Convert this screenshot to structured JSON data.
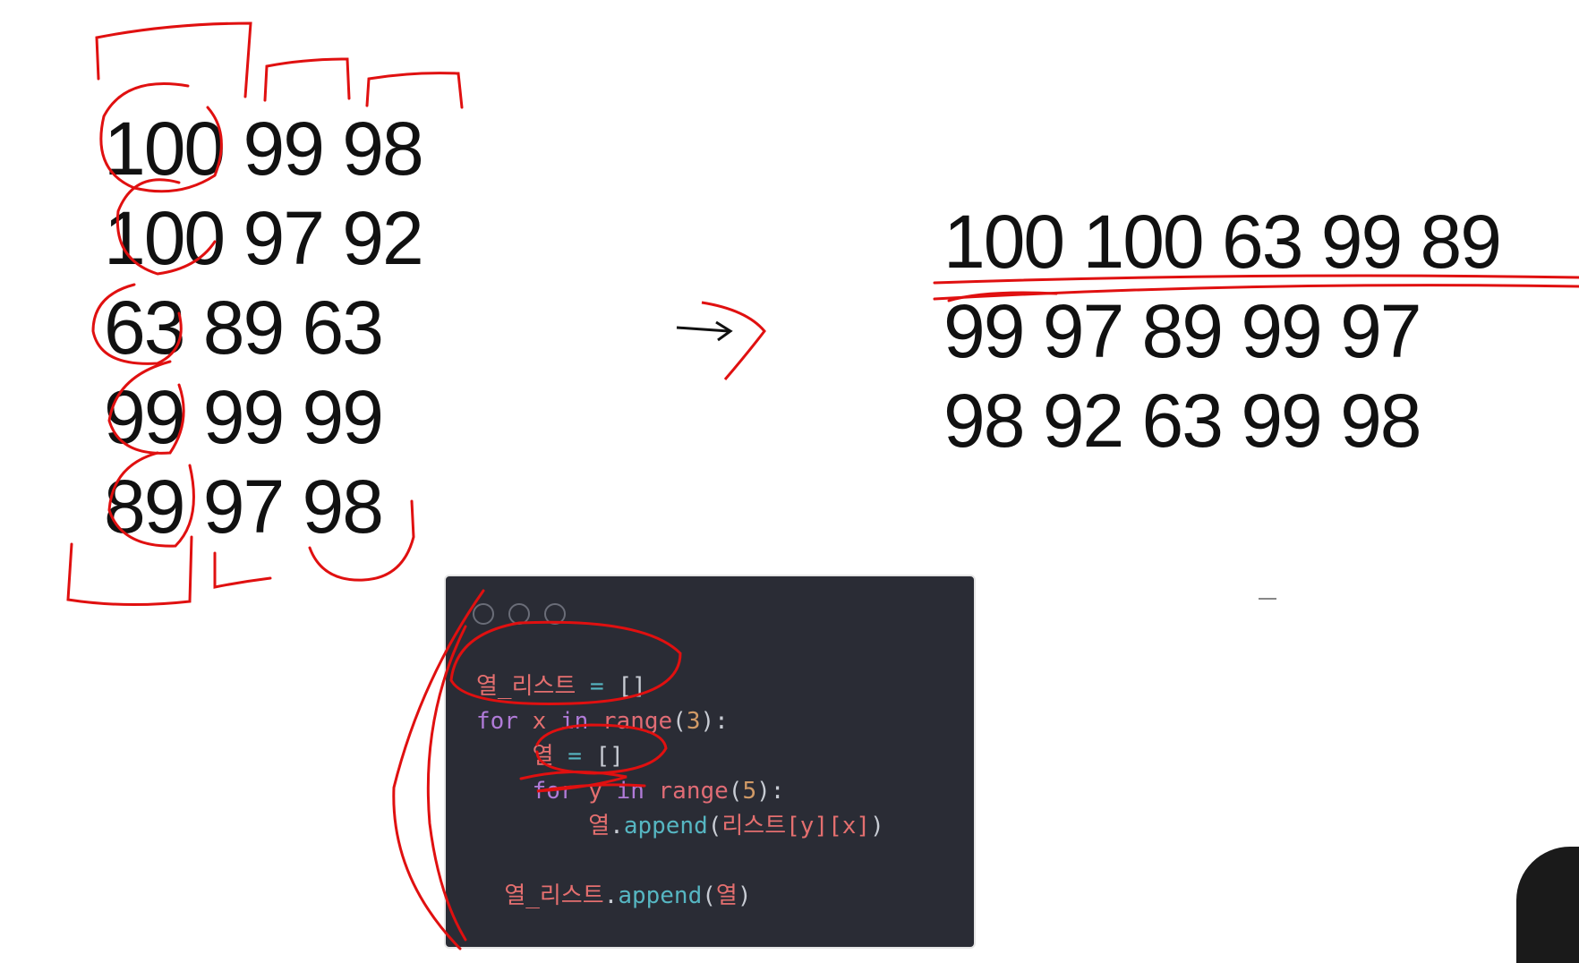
{
  "left_matrix": {
    "rows": [
      "100 99 98",
      "100 97 92",
      "63 89 63",
      "99 99 99",
      "89 97 98"
    ]
  },
  "right_matrix": {
    "rows": [
      "100 100 63 99 89",
      "99 97 89 99 97",
      "98 92 63 99 98"
    ]
  },
  "code": {
    "line1_var": "열_리스트",
    "line1_op": " = ",
    "line1_val": "[]",
    "line2_kw": "for",
    "line2_var": " x ",
    "line2_in": "in",
    "line2_fn": " range",
    "line2_open": "(",
    "line2_num": "3",
    "line2_close": "):",
    "line3_var": "열",
    "line3_op": " = ",
    "line3_val": "[]",
    "line4_kw": "for",
    "line4_var": " y ",
    "line4_in": "in",
    "line4_fn": " range",
    "line4_open": "(",
    "line4_num": "5",
    "line4_close": "):",
    "line5_var": "열",
    "line5_dot": ".",
    "line5_meth": "append",
    "line5_open": "(",
    "line5_arg": "리스트",
    "line5_idx1": "[y]",
    "line5_idx2": "[x]",
    "line5_close": ")",
    "line7_var": "열_리스트",
    "line7_dot": ".",
    "line7_meth": "append",
    "line7_open": "(",
    "line7_arg": "열",
    "line7_close": ")"
  },
  "colors": {
    "annotation": "#e01010",
    "code_bg": "#2a2c35"
  },
  "icons": {
    "arrow": "arrow-right-icon",
    "window_controls": "window-dot-icon"
  }
}
